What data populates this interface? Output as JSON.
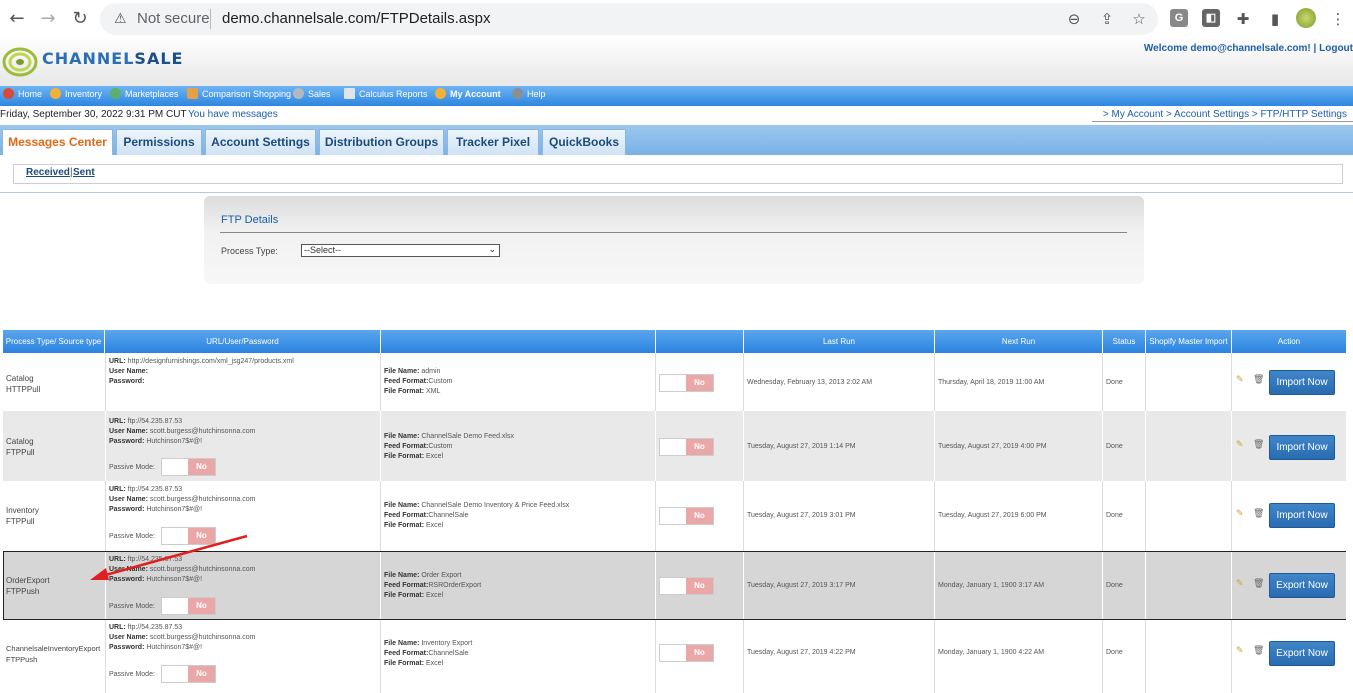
{
  "browser": {
    "not_secure": "Not secure",
    "url": "demo.channelsale.com/FTPDetails.aspx"
  },
  "header": {
    "logo_text_a": "CHANNEL",
    "logo_text_b": "SALE",
    "welcome": "Welcome demo@channelsale.com! | Logout"
  },
  "menu": [
    "Home",
    "Inventory",
    "Marketplaces",
    "Comparison Shopping",
    "Sales",
    "Calculus Reports",
    "My Account",
    "Help"
  ],
  "info": {
    "date": "Friday, September 30, 2022 9:31 PM CUT",
    "messages": "You have messages",
    "breadcrumb": "> My Account > Account Settings > FTP/HTTP Settings"
  },
  "tabs": [
    "Messages Center",
    "Permissions",
    "Account Settings",
    "Distribution Groups",
    "Tracker Pixel",
    "QuickBooks"
  ],
  "sub_links": {
    "received": "Received",
    "sep": "|",
    "sent": "Sent"
  },
  "ftp_panel": {
    "title": "FTP Details",
    "process_label": "Process Type:",
    "process_value": "--Select--"
  },
  "table": {
    "headers": [
      "Process Type/ Source type",
      "URL/User/Password",
      "",
      "",
      "Last Run",
      "Next Run",
      "Status",
      "Shopify Master Import",
      "Action"
    ],
    "labels": {
      "url": "URL:",
      "user": "User Name:",
      "password": "Password:",
      "passive": "Passive Mode:",
      "file_name": "File Name:",
      "feed_format": "Feed Format:",
      "file_format": "File Format:"
    },
    "toggle_off": "No",
    "rows": [
      {
        "type": "Catalog",
        "source": "HTTPPull",
        "url": "http://designfurnishings.com/xml_jsg247/products.xml",
        "user": "",
        "password": "",
        "file_name": "admin",
        "feed_format": "Custom",
        "file_format": "XML",
        "last_run": "Wednesday, February 13, 2013 2:02 AM",
        "next_run": "Thursday, April 18, 2019 11:00 AM",
        "status": "Done",
        "action": "Import Now"
      },
      {
        "type": "Catalog",
        "source": "FTPPull",
        "url": "ftp://54.235.87.53",
        "user": "scott.burgess@hutchinsonna.com",
        "password": "Hutchinson7$#@!",
        "file_name": "ChannelSale Demo Feed.xlsx",
        "feed_format": "Custom",
        "file_format": "Excel",
        "last_run": "Tuesday, August 27, 2019 1:14 PM",
        "next_run": "Tuesday, August 27, 2019 4:00 PM",
        "status": "Done",
        "action": "Import Now"
      },
      {
        "type": "Inventory",
        "source": "FTPPull",
        "url": "ftp://54.235.87.53",
        "user": "scott.burgess@hutchinsonna.com",
        "password": "Hutchinson7$#@!",
        "file_name": "ChannelSale Demo Inventory & Price Feed.xlsx",
        "feed_format": "ChannelSale",
        "file_format": "Excel",
        "last_run": "Tuesday, August 27, 2019 3:01 PM",
        "next_run": "Tuesday, August 27, 2019 6:00 PM",
        "status": "Done",
        "action": "Import Now"
      },
      {
        "type": "OrderExport",
        "source": "FTPPush",
        "url": "ftp://54.235.87.53",
        "user": "scott.burgess@hutchinsonna.com",
        "password": "Hutchinson7$#@!",
        "file_name": "Order Export",
        "feed_format": "RSROrderExport",
        "file_format": "Excel",
        "last_run": "Tuesday, August 27, 2019 3:17 PM",
        "next_run": "Monday, January 1, 1900 3:17 AM",
        "status": "Done",
        "action": "Export Now"
      },
      {
        "type": "ChannelsaleInventoryExport",
        "source": "FTPPush",
        "url": "ftp://54.235.87.53",
        "user": "scott.burgess@hutchinsonna.com",
        "password": "Hutchinson7$#@!",
        "file_name": "Inventory Export",
        "feed_format": "ChannelSale",
        "file_format": "Excel",
        "last_run": "Tuesday, August 27, 2019 4:22 PM",
        "next_run": "Monday, January 1, 1900 4:22 AM",
        "status": "Done",
        "action": "Export Now"
      }
    ]
  },
  "colors": {
    "accent": "#2b83df",
    "tab_active": "#e06a18",
    "toggle_no": "#e9a7a7",
    "annotation_arrow": "#e02020"
  }
}
